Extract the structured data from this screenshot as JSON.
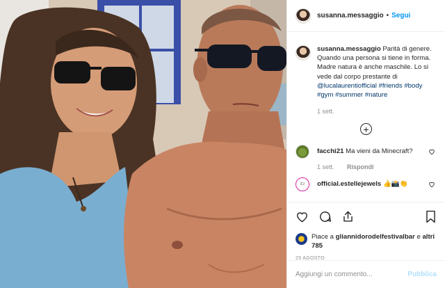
{
  "post": {
    "username": "susanna.messaggio",
    "separator": "•",
    "follow_label": "Segui",
    "caption": {
      "username": "susanna.messaggio",
      "text": "Parità di genere. Quando una persona si tiene in forma. Madre natura è anche maschile. Lo si vede dal corpo prestante di",
      "mention": "@lucalaurentiofficial",
      "hashtags": [
        "#friends",
        "#body",
        "#gym",
        "#summer",
        "#nature"
      ],
      "time": "1 sett."
    },
    "load_more_label": "+",
    "comments": [
      {
        "username": "facchi21",
        "text": "Ma vieni da Minecraft?",
        "time": "1 sett.",
        "reply_label": "Rispondi"
      },
      {
        "username": "official.estellejewels",
        "text": "👍📸👏",
        "avatar_text": "EJ"
      }
    ],
    "likes": {
      "prefix": "Piace a",
      "user": "gliannidorodelfestivalbar",
      "connector": "e",
      "others": "altri 785"
    },
    "date": "25 AGOSTO",
    "comment_input": {
      "placeholder": "Aggiungi un commento...",
      "post_label": "Pubblica"
    }
  },
  "icons": {
    "like": "heart-icon",
    "comment": "comment-icon",
    "share": "share-icon",
    "save": "bookmark-icon",
    "more": "plus-circle-icon"
  },
  "colors": {
    "link_blue": "#0095f6",
    "hashtag_blue": "#00376b",
    "muted_gray": "#8e8e8e",
    "text": "#262626",
    "post_disabled": "#b2dffc"
  }
}
